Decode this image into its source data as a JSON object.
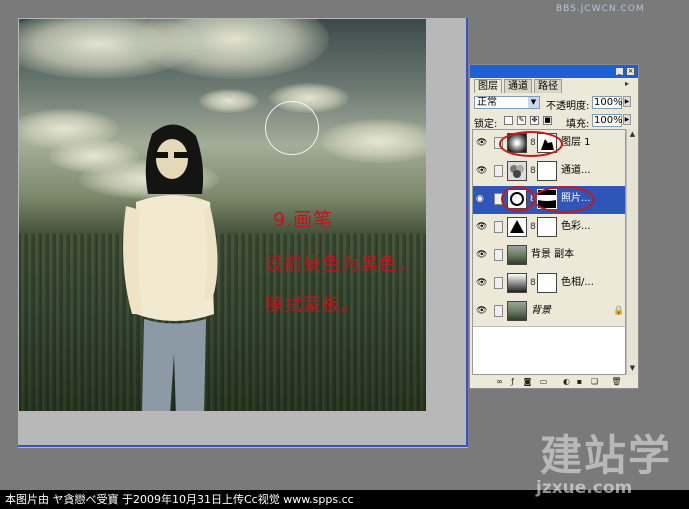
{
  "watermark": {
    "site_top": "BBS.JCWCN.COM",
    "logo_text": "建站学",
    "url": "jzxue.com"
  },
  "tutorial": {
    "step_title": "9.画笔",
    "line1": "设前景色为黑色，",
    "line2": "擦拭蒙板。",
    "text_color": "#c2141c"
  },
  "layers_panel": {
    "tabs": [
      {
        "label": "图层",
        "active": true
      },
      {
        "label": "通道",
        "active": false
      },
      {
        "label": "路径",
        "active": false
      }
    ],
    "blend_mode": "正常",
    "opacity_label": "不透明度:",
    "opacity_value": "100%",
    "lock_label": "锁定:",
    "fill_label": "填充:",
    "fill_value": "100%",
    "layers": [
      {
        "name": "图层 1",
        "selected": false,
        "has_mask": true,
        "circled": true
      },
      {
        "name": "通道...",
        "selected": false,
        "has_mask": true,
        "circled": false
      },
      {
        "name": "照片...",
        "selected": true,
        "has_mask": true,
        "circled": true
      },
      {
        "name": "色彩...",
        "selected": false,
        "has_mask": true,
        "circled": false
      },
      {
        "name": "背景 副本",
        "selected": false,
        "has_mask": false,
        "circled": false
      },
      {
        "name": "色相/...",
        "selected": false,
        "has_mask": true,
        "circled": false
      },
      {
        "name": "背景",
        "selected": false,
        "has_mask": false,
        "locked": true,
        "circled": false
      }
    ],
    "accent_color": "#2f55b8"
  },
  "footer": {
    "credit": "本图片由 ヤ貪戀べ受寶 于2009年10月31日上传Cc视觉 www.spps.cc"
  }
}
